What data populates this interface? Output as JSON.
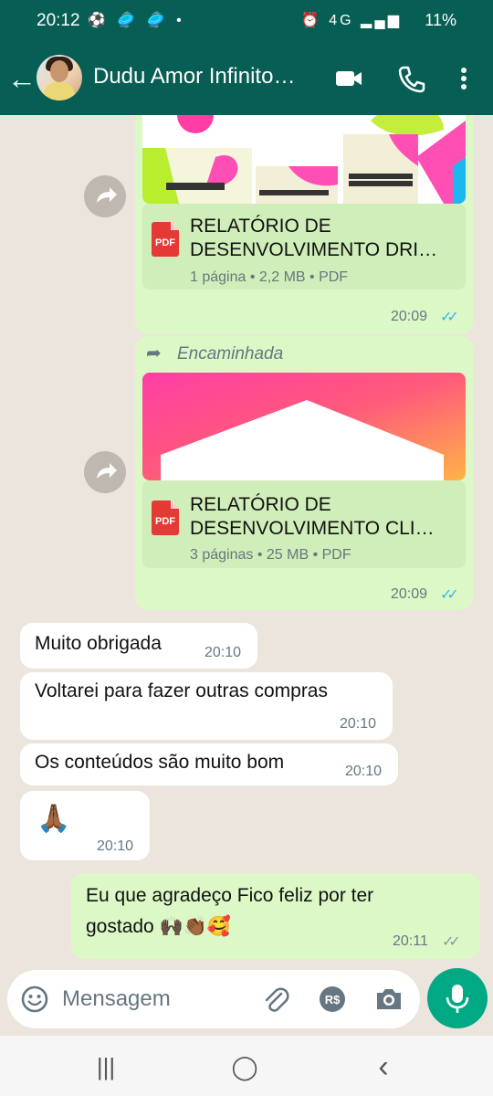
{
  "status_bar": {
    "time": "20:12",
    "left_icons": "⚽ 🥏 🥏 •",
    "system_icons": "⏰ 4G ▂▄▆",
    "battery": "11%"
  },
  "header": {
    "contact_name": "Dudu Amor Infinito…"
  },
  "messages": [
    {
      "direction": "outgoing",
      "type": "document",
      "title_line1": "RELATÓRIO DE",
      "title_line2": "DESENVOLVIMENTO DRI…",
      "meta": "1 página • 2,2 MB • PDF",
      "pdf_label": "PDF",
      "time": "20:09",
      "read": true
    },
    {
      "direction": "outgoing",
      "type": "document",
      "forwarded_label": "Encaminhada",
      "title_line1": "RELATÓRIO DE",
      "title_line2": "DESENVOLVIMENTO CLI…",
      "meta": "3 páginas • 25 MB • PDF",
      "pdf_label": "PDF",
      "time": "20:09",
      "read": true
    },
    {
      "direction": "incoming",
      "text": "Muito obrigada",
      "time": "20:10"
    },
    {
      "direction": "incoming",
      "text": "Voltarei para fazer outras compras",
      "time": "20:10"
    },
    {
      "direction": "incoming",
      "text": "Os conteúdos são muito bom",
      "time": "20:10"
    },
    {
      "direction": "incoming",
      "text": "🙏🏾",
      "time": "20:10"
    },
    {
      "direction": "outgoing",
      "text_line1": "Eu que agradeço Fico feliz por ter",
      "text_line2": "gostado 🙌🏿👏🏾🥰",
      "time": "20:11",
      "read": false
    }
  ],
  "composer": {
    "placeholder": "Mensagem"
  },
  "colors": {
    "header": "#075e54",
    "outgoing_bubble": "#dcf8c6",
    "incoming_bubble": "#ffffff",
    "accent": "#00a884",
    "read_ticks": "#34b7f1"
  },
  "navbar": {
    "recents": "|||",
    "home": "◯",
    "back": "‹"
  }
}
